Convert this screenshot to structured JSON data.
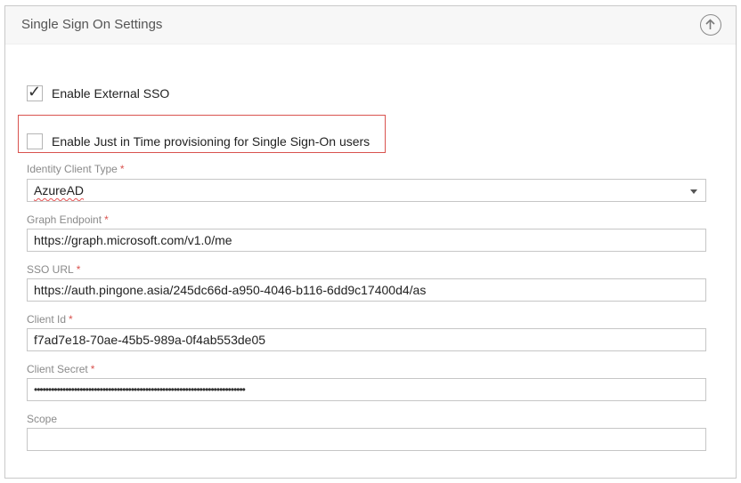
{
  "panel": {
    "title": "Single Sign On Settings",
    "collapse_icon": "arrow-up-circle-icon"
  },
  "checkboxes": {
    "enable_external_sso": {
      "label": "Enable External SSO",
      "checked": true
    },
    "enable_jit": {
      "label": "Enable Just in Time provisioning for Single Sign-On users",
      "checked": false
    }
  },
  "fields": {
    "identity_client_type": {
      "label": "Identity Client Type",
      "required": "*",
      "value": "AzureAD"
    },
    "graph_endpoint": {
      "label": "Graph Endpoint",
      "required": "*",
      "value": "https://graph.microsoft.com/v1.0/me"
    },
    "sso_url": {
      "label": "SSO URL",
      "required": "*",
      "value": "https://auth.pingone.asia/245dc66d-a950-4046-b116-6dd9c17400d4/as"
    },
    "client_id": {
      "label": "Client Id",
      "required": "*",
      "value": "f7ad7e18-70ae-45b5-989a-0f4ab553de05"
    },
    "client_secret": {
      "label": "Client Secret",
      "required": "*",
      "value": "••••••••••••••••••••••••••••••••••••••••••••••••••••••••••••••••••••••••••"
    },
    "scope": {
      "label": "Scope",
      "value": ""
    }
  },
  "colors": {
    "required": "#d9534f",
    "highlight_border": "#d9534f"
  }
}
